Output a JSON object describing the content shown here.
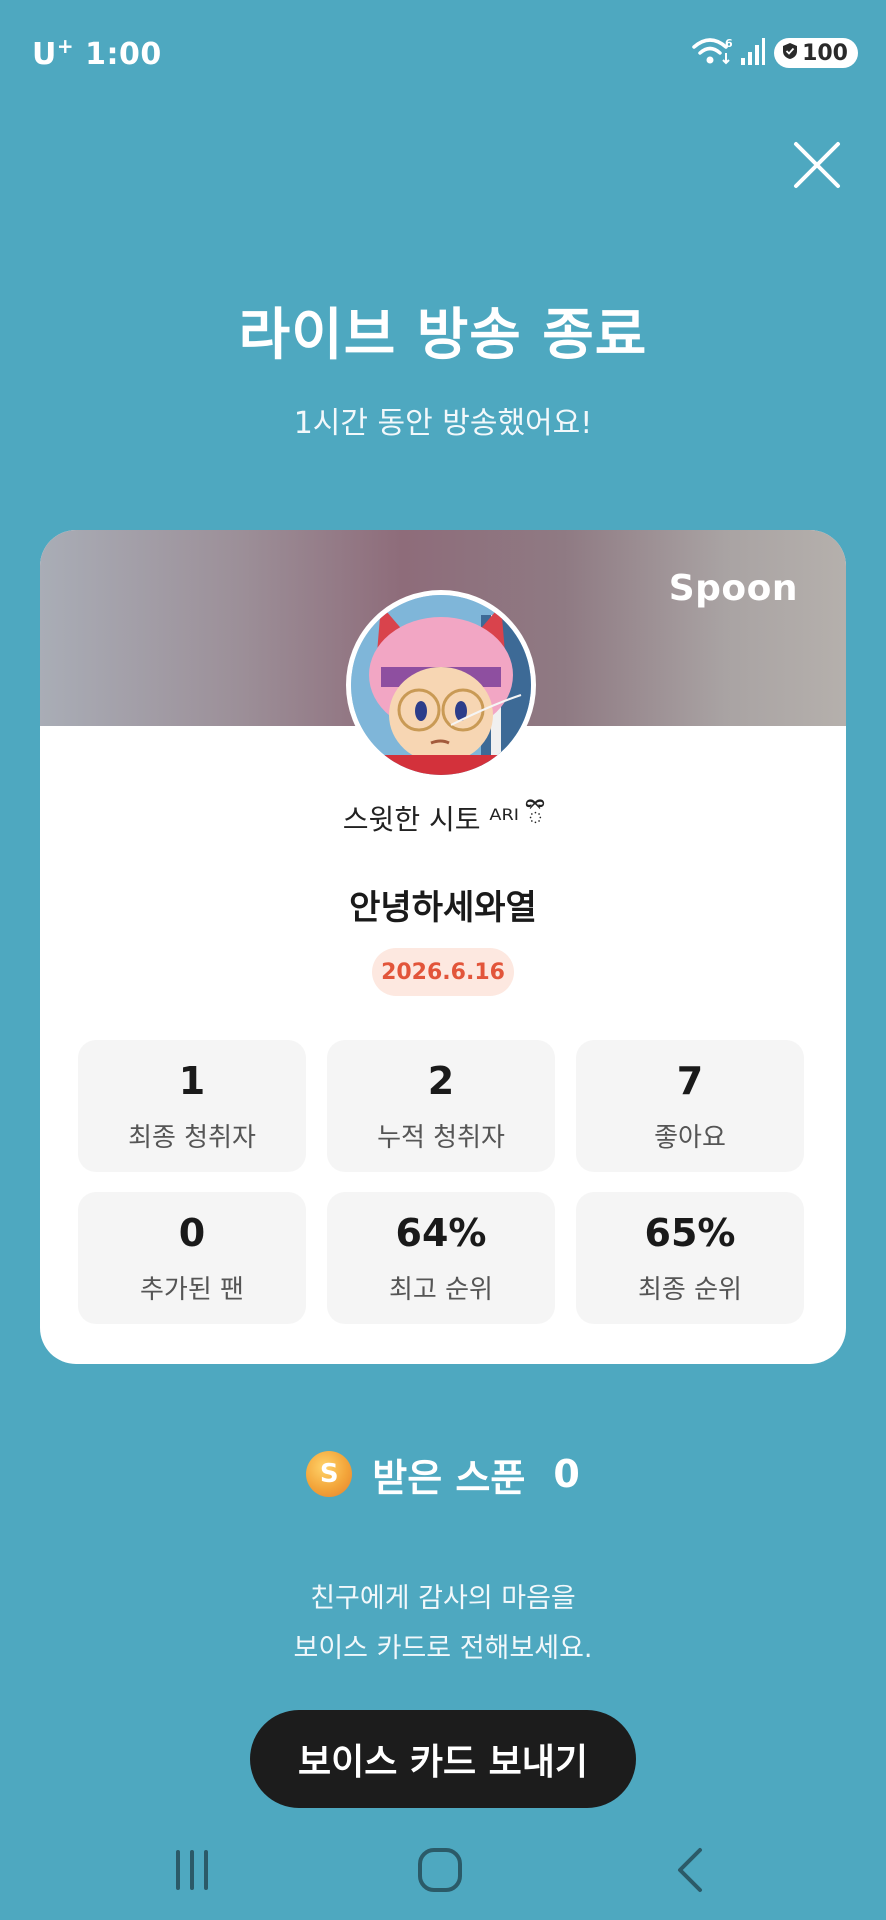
{
  "status_bar": {
    "carrier": "U",
    "carrier_sup": "+",
    "time": "1:00",
    "wifi_badge": "6",
    "battery": "100"
  },
  "header": {
    "title": "라이브 방송 종료",
    "subtitle": "1시간 동안 방송했어요!"
  },
  "card": {
    "brand": "Spoon",
    "nickname": "스윗한 시토 ᴬᴿᴵ ྀི",
    "stream_title": "안녕하세와열",
    "date": "2026.6.16",
    "stats": [
      {
        "value": "1",
        "label": "최종 청취자"
      },
      {
        "value": "2",
        "label": "누적 청취자"
      },
      {
        "value": "7",
        "label": "좋아요"
      },
      {
        "value": "0",
        "label": "추가된 팬"
      },
      {
        "value": "64%",
        "label": "최고 순위"
      },
      {
        "value": "65%",
        "label": "최종 순위"
      }
    ]
  },
  "spoons": {
    "coin_letter": "S",
    "label": "받은 스푼",
    "count": "0"
  },
  "thanks": {
    "line1": "친구에게 감사의 마음을",
    "line2": "보이스 카드로 전해보세요."
  },
  "voice_button": {
    "label": "보이스 카드 보내기"
  },
  "colors": {
    "background": "#4ea8c0",
    "date_badge_text": "#e2553a",
    "date_badge_bg": "#fde8e0",
    "button_bg": "#1c1c1c"
  }
}
